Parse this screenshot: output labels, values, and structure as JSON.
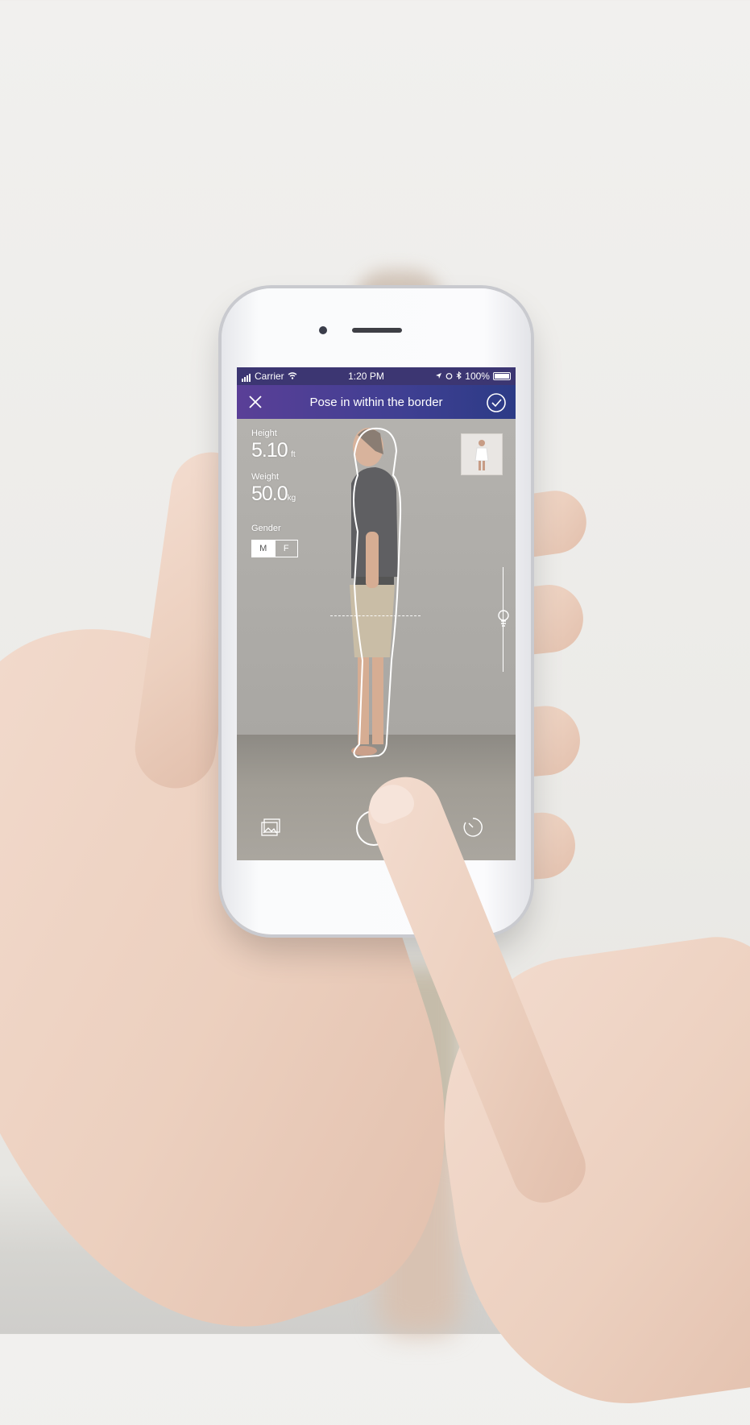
{
  "status_bar": {
    "carrier": "Carrier",
    "time": "1:20 PM",
    "battery": "100%"
  },
  "nav": {
    "title": "Pose in within the border",
    "close_icon": "close-icon",
    "confirm_icon": "check-circle-icon"
  },
  "measurements": {
    "height_label": "Height",
    "height_value": "5.10",
    "height_unit": "ft",
    "weight_label": "Weight",
    "weight_value": "50.0",
    "weight_unit": "kg",
    "gender_label": "Gender",
    "gender_options": [
      "M",
      "F"
    ],
    "gender_selected": "M"
  },
  "controls": {
    "gallery_icon": "gallery-icon",
    "shutter_icon": "shutter-button",
    "flip_icon": "camera-flip-icon",
    "timer_icon": "timer-icon",
    "brightness_icon": "lightbulb-icon"
  },
  "colors": {
    "nav_start": "#5a3f97",
    "nav_end": "#2c3b86",
    "status_bar": "#3c3672"
  }
}
